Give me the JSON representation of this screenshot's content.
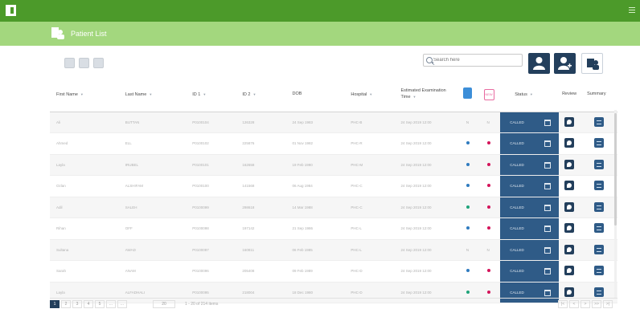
{
  "app": {
    "title": "Patient List"
  },
  "search": {
    "placeholder": "Search here"
  },
  "table": {
    "columns": [
      {
        "label": "First Name"
      },
      {
        "label": "Last Name"
      },
      {
        "label": "ID 1"
      },
      {
        "label": "ID 2"
      },
      {
        "label": "DOB"
      },
      {
        "label": "Hospital"
      },
      {
        "label": "Estimated Examination Time"
      },
      {
        "label": ""
      },
      {
        "label": ""
      },
      {
        "label": "Status"
      },
      {
        "label": "Review"
      },
      {
        "label": "Summary"
      }
    ],
    "pink_icon_text": "NEW",
    "rows": [
      {
        "first": "Ali",
        "last": "BUTTAN",
        "id1": "P0100104",
        "id2": "126328",
        "dob": "24 Sep 1983",
        "hospital": "PHC-B",
        "time": "24 Sep 2019 12:00",
        "c1": "N",
        "c2": "N",
        "status": "CALLED",
        "dot1": "none",
        "dot2": "none"
      },
      {
        "first": "Ahmed",
        "last": "ELL",
        "id1": "P0100102",
        "id2": "225876",
        "dob": "01 Nov 1982",
        "hospital": "PHC-R",
        "time": "24 Sep 2019 12:00",
        "c1": "",
        "c2": "",
        "status": "CALLED",
        "dot1": "#2f7bbf",
        "dot2": "#d4145a"
      },
      {
        "first": "Layla",
        "last": "IRUBEL",
        "id1": "P0100101",
        "id2": "162658",
        "dob": "19 Feb 1990",
        "hospital": "PHC-M",
        "time": "24 Sep 2019 12:00",
        "c1": "",
        "c2": "",
        "status": "CALLED",
        "dot1": "#2f7bbf",
        "dot2": "#d4145a"
      },
      {
        "first": "Ozlan",
        "last": "ALSHIFAM",
        "id1": "P0100100",
        "id2": "141568",
        "dob": "06 Aug 1984",
        "hospital": "PHC-C",
        "time": "24 Sep 2019 12:00",
        "c1": "",
        "c2": "",
        "status": "CALLED",
        "dot1": "#2f7bbf",
        "dot2": "#d4145a"
      },
      {
        "first": "Adil",
        "last": "SALEH",
        "id1": "P0100099",
        "id2": "298618",
        "dob": "14 Mar 1988",
        "hospital": "PHC-C",
        "time": "24 Sep 2019 12:00",
        "c1": "",
        "c2": "",
        "status": "CALLED",
        "dot1": "#1fa37a",
        "dot2": "#d4145a"
      },
      {
        "first": "Rihan",
        "last": "OFF",
        "id1": "P0100098",
        "id2": "197142",
        "dob": "21 Sep 1986",
        "hospital": "PHC-L",
        "time": "24 Sep 2019 12:00",
        "c1": "",
        "c2": "",
        "status": "CALLED",
        "dot1": "#2f7bbf",
        "dot2": "#d4145a"
      },
      {
        "first": "Sultana",
        "last": "AWAD",
        "id1": "P0100097",
        "id2": "160811",
        "dob": "06 Feb 1985",
        "hospital": "PHC-L",
        "time": "24 Sep 2019 12:00",
        "c1": "N",
        "c2": "N",
        "status": "CALLED",
        "dot1": "none",
        "dot2": "none"
      },
      {
        "first": "Sarah",
        "last": "ANAM",
        "id1": "P0100096",
        "id2": "205408",
        "dob": "09 Feb 1989",
        "hospital": "PHC-D",
        "time": "24 Sep 2019 12:00",
        "c1": "",
        "c2": "",
        "status": "CALLED",
        "dot1": "#2f7bbf",
        "dot2": "#d4145a"
      },
      {
        "first": "Layla",
        "last": "ALFADHALI",
        "id1": "P0100095",
        "id2": "218004",
        "dob": "18 Dec 1980",
        "hospital": "PHC-D",
        "time": "24 Sep 2019 12:00",
        "c1": "",
        "c2": "",
        "status": "CALLED",
        "dot1": "#1fa37a",
        "dot2": "#d4145a"
      }
    ]
  },
  "pagination": {
    "pages": [
      "1",
      "2",
      "3",
      "4",
      "5",
      "...",
      "..."
    ],
    "per_page": "20",
    "items_info": "1 - 20 of 214 items",
    "nav": [
      "|<",
      "<",
      ">",
      ">>",
      ">|"
    ]
  },
  "colors": {
    "topbar": "#4c9a2a",
    "subbar": "#a3d77e",
    "navy": "#233f5c",
    "status_blue": "#2f5b87"
  },
  "icons": {
    "toolbar": [
      "grid-icon",
      "print-icon",
      "export-icon"
    ],
    "actions": [
      "user-icon",
      "user-add-icon",
      "users-icon"
    ]
  }
}
